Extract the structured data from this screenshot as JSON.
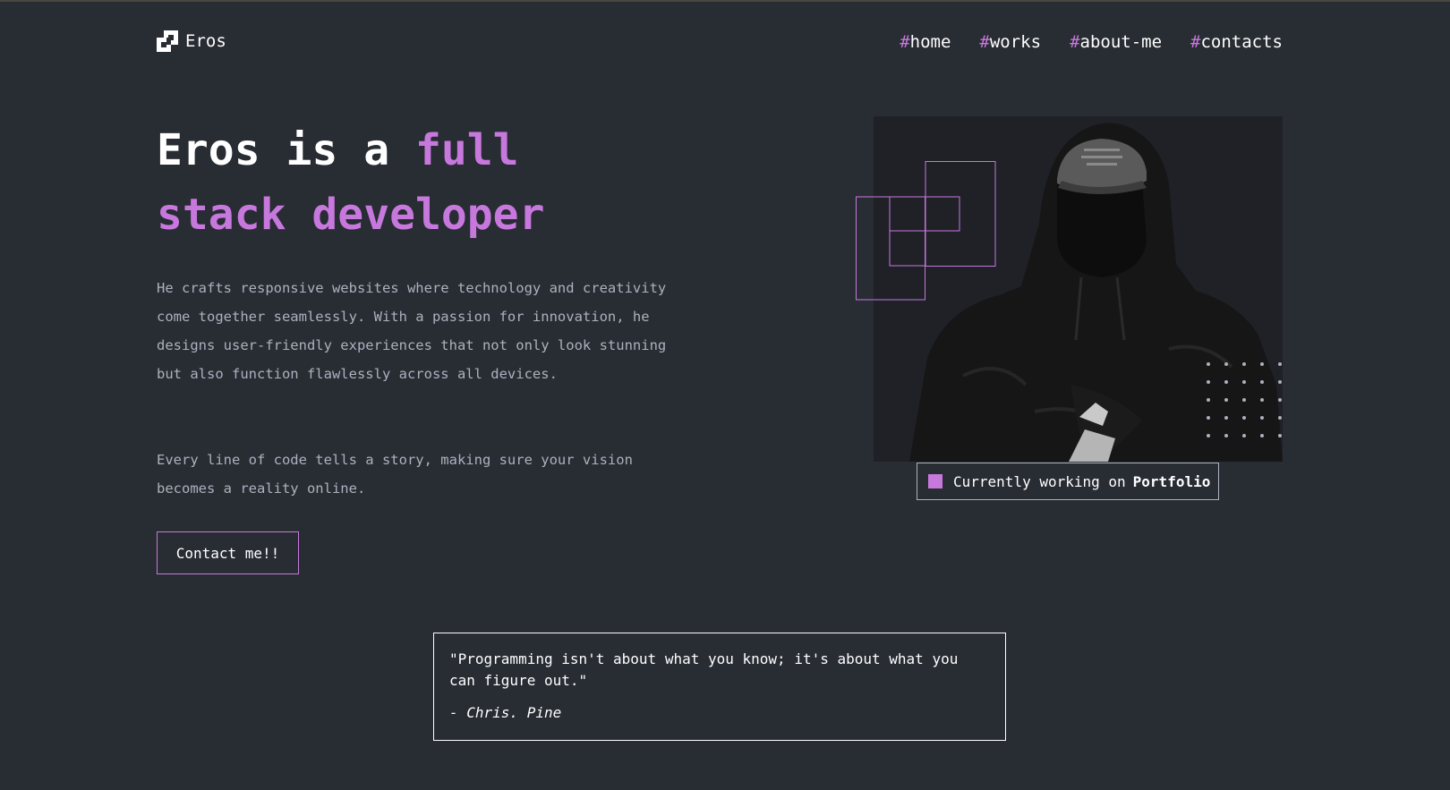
{
  "header": {
    "logo_text": "Eros",
    "nav": [
      {
        "hash": "#",
        "label": "home"
      },
      {
        "hash": "#",
        "label": "works"
      },
      {
        "hash": "#",
        "label": "about-me"
      },
      {
        "hash": "#",
        "label": "contacts"
      }
    ]
  },
  "hero": {
    "headline": {
      "part1": "Eros is a ",
      "accent1": "full",
      "accent2": "stack developer"
    },
    "paragraph1": "He crafts responsive websites where technology and creativity come together seamlessly. With a passion for innovation, he designs user-friendly experiences that not only look stunning but also function flawlessly across all devices.",
    "paragraph2": "Every line of code tells a story, making sure your vision becomes a reality online.",
    "contact_button": "Contact me!!"
  },
  "status": {
    "prefix": "Currently working on",
    "project": "Portfolio"
  },
  "quote": {
    "text": "\"Programming isn't about what you know; it's about what you can figure out.\"",
    "author": "- Chris. Pine"
  },
  "colors": {
    "background": "#282c33",
    "accent": "#c778dd",
    "muted_text": "#abb2bf",
    "text": "#ffffff"
  }
}
